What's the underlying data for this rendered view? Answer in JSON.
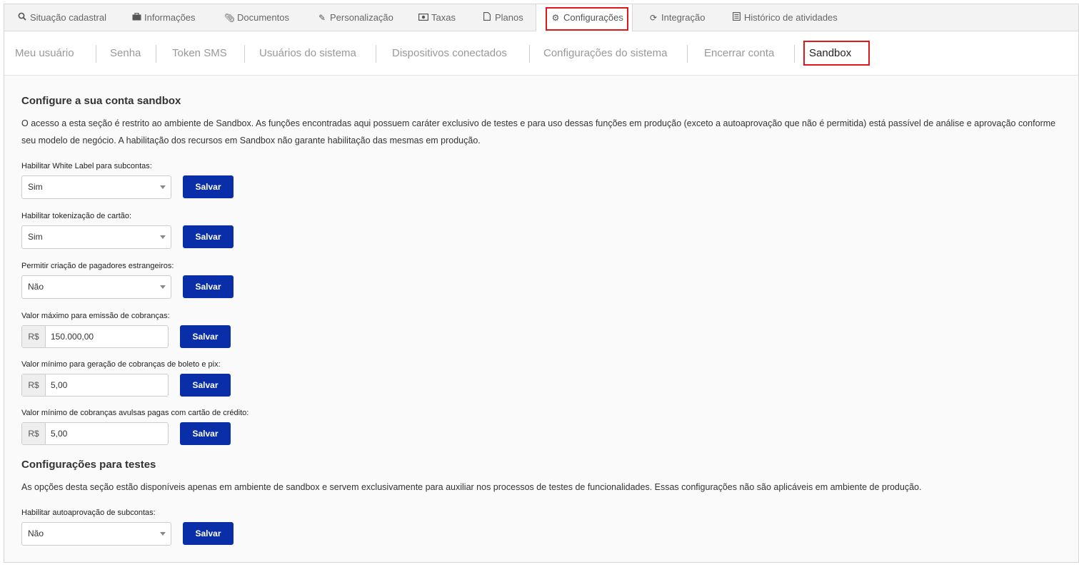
{
  "top_tabs": [
    {
      "label": "Situação cadastral",
      "icon": "search-icon"
    },
    {
      "label": "Informações",
      "icon": "briefcase-icon"
    },
    {
      "label": "Documentos",
      "icon": "paperclip-icon"
    },
    {
      "label": "Personalização",
      "icon": "pencil-icon"
    },
    {
      "label": "Taxas",
      "icon": "money-icon"
    },
    {
      "label": "Planos",
      "icon": "file-icon"
    },
    {
      "label": "Configurações",
      "icon": "gear-icon",
      "active": true
    },
    {
      "label": "Integração",
      "icon": "refresh-icon"
    },
    {
      "label": "Histórico de atividades",
      "icon": "list-icon"
    }
  ],
  "sub_tabs": [
    {
      "label": "Meu usuário"
    },
    {
      "label": "Senha"
    },
    {
      "label": "Token SMS"
    },
    {
      "label": "Usuários do sistema"
    },
    {
      "label": "Dispositivos conectados"
    },
    {
      "label": "Configurações do sistema"
    },
    {
      "label": "Encerrar conta"
    },
    {
      "label": "Sandbox",
      "active": true
    }
  ],
  "sandbox": {
    "title": "Configure a sua conta sandbox",
    "description": "O acesso a esta seção é restrito ao ambiente de Sandbox. As funções encontradas aqui possuem caráter exclusivo de testes e para uso dessas funções em produção (exceto a autoaprovação que não é permitida) está passível de análise e aprovação conforme seu modelo de negócio. A habilitação dos recursos em Sandbox não garante habilitação das mesmas em produção.",
    "fields": [
      {
        "label": "Habilitar White Label para subcontas:",
        "type": "select",
        "value": "Sim"
      },
      {
        "label": "Habilitar tokenização de cartão:",
        "type": "select",
        "value": "Sim"
      },
      {
        "label": "Permitir criação de pagadores estrangeiros:",
        "type": "select",
        "value": "Não"
      },
      {
        "label": "Valor máximo para emissão de cobranças:",
        "type": "money",
        "prefix": "R$",
        "value": "150.000,00"
      },
      {
        "label": "Valor mínimo para geração de cobranças de boleto e pix:",
        "type": "money",
        "prefix": "R$",
        "value": "5,00"
      },
      {
        "label": "Valor mínimo de cobranças avulsas pagas com cartão de crédito:",
        "type": "money",
        "prefix": "R$",
        "value": "5,00"
      }
    ]
  },
  "tests": {
    "title": "Configurações para testes",
    "description": "As opções desta seção estão disponíveis apenas em ambiente de sandbox e servem exclusivamente para auxiliar nos processos de testes de funcionalidades. Essas configurações não são aplicáveis em ambiente de produção.",
    "field": {
      "label": "Habilitar autoaprovação de subcontas:",
      "type": "select",
      "value": "Não"
    }
  },
  "save_label": "Salvar",
  "colors": {
    "primary_button": "#0a2ea8",
    "highlight": "#e0161b"
  }
}
